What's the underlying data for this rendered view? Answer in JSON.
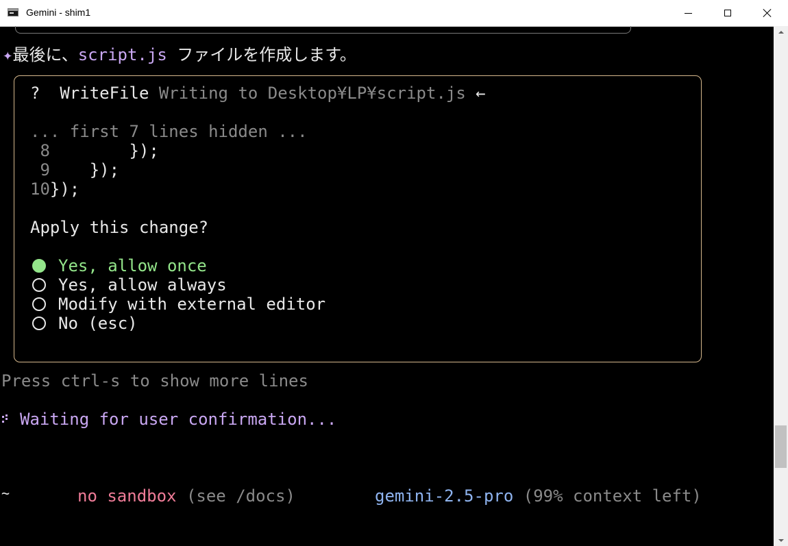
{
  "window": {
    "title": "Gemini - shim1",
    "icon": "console-icon"
  },
  "terminal": {
    "intro": {
      "sparkle": "✦",
      "before": "最後に、",
      "filename": "script.js",
      "after": " ファイルを作成します。"
    },
    "dialog": {
      "question_mark": "?",
      "tool": "WriteFile",
      "description": "Writing to Desktop¥LP¥script.js",
      "arrow": "←",
      "hidden_note": "... first 7 lines hidden ...",
      "code": [
        {
          "num": " 8",
          "text": "        });"
        },
        {
          "num": " 9",
          "text": "    });"
        },
        {
          "num": "10",
          "text": "});"
        }
      ],
      "prompt": "Apply this change?",
      "options": [
        {
          "label": "Yes, allow once",
          "selected": true
        },
        {
          "label": "Yes, allow always",
          "selected": false
        },
        {
          "label": "Modify with external editor",
          "selected": false
        },
        {
          "label": "No (esc)",
          "selected": false
        }
      ]
    },
    "more_lines_hint": "Press ctrl-s to show more lines",
    "waiting": "Waiting for user confirmation...",
    "footer": {
      "cwd": "~",
      "sandbox": "no sandbox",
      "sandbox_note": "(see /docs)",
      "model": "gemini-2.5-pro",
      "context": "(99% context left)"
    }
  },
  "colors": {
    "background": "#000000",
    "accent_purple": "#c9a7f2",
    "selected_green": "#93e58a",
    "sandbox_pink": "#f07c98",
    "model_blue": "#8fb4f0",
    "dialog_border": "#d7b98e",
    "dim_gray": "#8a8a8a"
  }
}
